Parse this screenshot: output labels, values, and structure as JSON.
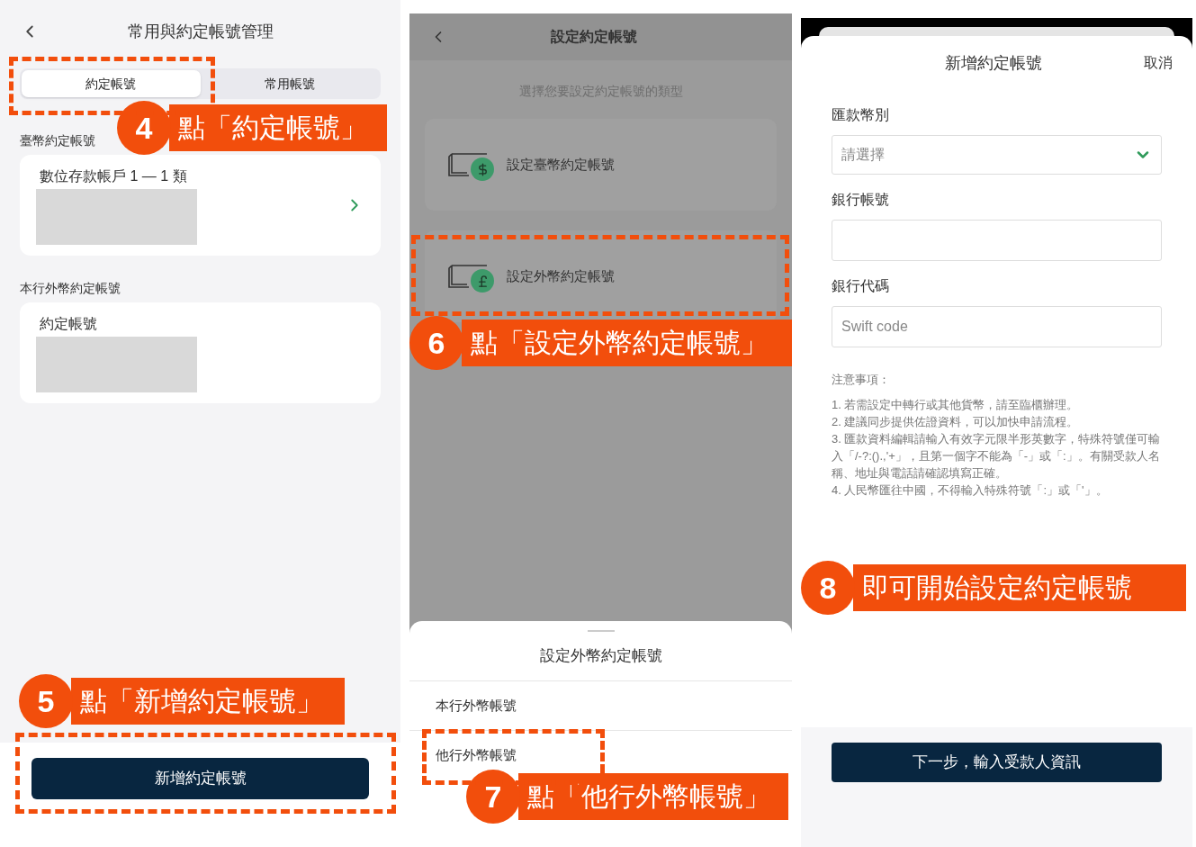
{
  "screen_1": {
    "title": "常用與約定帳號管理",
    "tabs": [
      {
        "label": "約定帳號",
        "selected": true
      },
      {
        "label": "常用帳號",
        "selected": false
      }
    ],
    "sections": [
      {
        "title": "臺幣約定帳號",
        "account": "數位存款帳戶 1 — 1 類",
        "has_chevron": true
      },
      {
        "title": "本行外幣約定帳號",
        "account": "約定帳號",
        "has_chevron": false
      }
    ],
    "button": "新增約定帳號",
    "callouts": [
      {
        "number": "4",
        "text": "點「約定帳號」"
      },
      {
        "number": "5",
        "text": "點「新增約定帳號」"
      }
    ]
  },
  "screen_2": {
    "title": "設定約定帳號",
    "subtitle": "選擇您要設定約定帳號的類型",
    "options": [
      {
        "label": "設定臺幣約定帳號",
        "kind": "dollar"
      },
      {
        "label": "設定外幣約定帳號",
        "kind": "pound"
      }
    ],
    "sheet": {
      "title": "設定外幣約定帳號",
      "items": [
        "本行外幣帳號",
        "他行外幣帳號"
      ]
    },
    "callouts": [
      {
        "number": "6",
        "text": "點「設定外幣約定帳號」"
      },
      {
        "number": "7",
        "text": "點「他行外幣帳號」"
      }
    ]
  },
  "screen_3": {
    "title": "新增約定帳號",
    "cancel": "取消",
    "fields": [
      {
        "label": "匯款幣別",
        "kind": "select",
        "placeholder": "請選擇"
      },
      {
        "label": "銀行帳號",
        "kind": "text"
      },
      {
        "label": "銀行代碼",
        "kind": "text",
        "placeholder": "Swift code"
      }
    ],
    "notes_title": "注意事項：",
    "notes": [
      "1. 若需設定中轉行或其他貨幣，請至臨櫃辦理。",
      "2. 建議同步提供佐證資料，可以加快申請流程。",
      "3. 匯款資料編輯請輸入有效字元限半形英數字，特殊符號僅可輸入「/-?:().,'+」，且第一個字不能為「-」或「:」。有關受款人名稱、地址與電話請確認填寫正確。",
      "4. 人民幣匯往中國，不得輸入特殊符號「:」或「'」。"
    ],
    "button": "下一步，輸入受款人資訊",
    "callouts": [
      {
        "number": "8",
        "text": "即可開始設定約定帳號"
      }
    ]
  }
}
